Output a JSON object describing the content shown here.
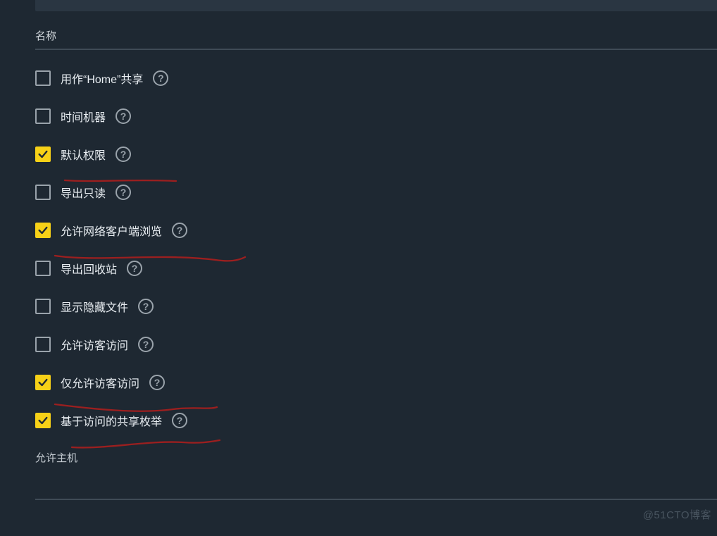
{
  "field_name_label": "名称",
  "options": [
    {
      "label": "用作“Home”共享",
      "checked": false
    },
    {
      "label": "时间机器",
      "checked": false
    },
    {
      "label": "默认权限",
      "checked": true
    },
    {
      "label": "导出只读",
      "checked": false
    },
    {
      "label": "允许网络客户端浏览",
      "checked": true
    },
    {
      "label": "导出回收站",
      "checked": false
    },
    {
      "label": "显示隐藏文件",
      "checked": false
    },
    {
      "label": "允许访客访问",
      "checked": false
    },
    {
      "label": "仅允许访客访问",
      "checked": true
    },
    {
      "label": "基于访问的共享枚举",
      "checked": true
    }
  ],
  "allowed_hosts_label": "允许主机",
  "watermark": "@51CTO博客"
}
